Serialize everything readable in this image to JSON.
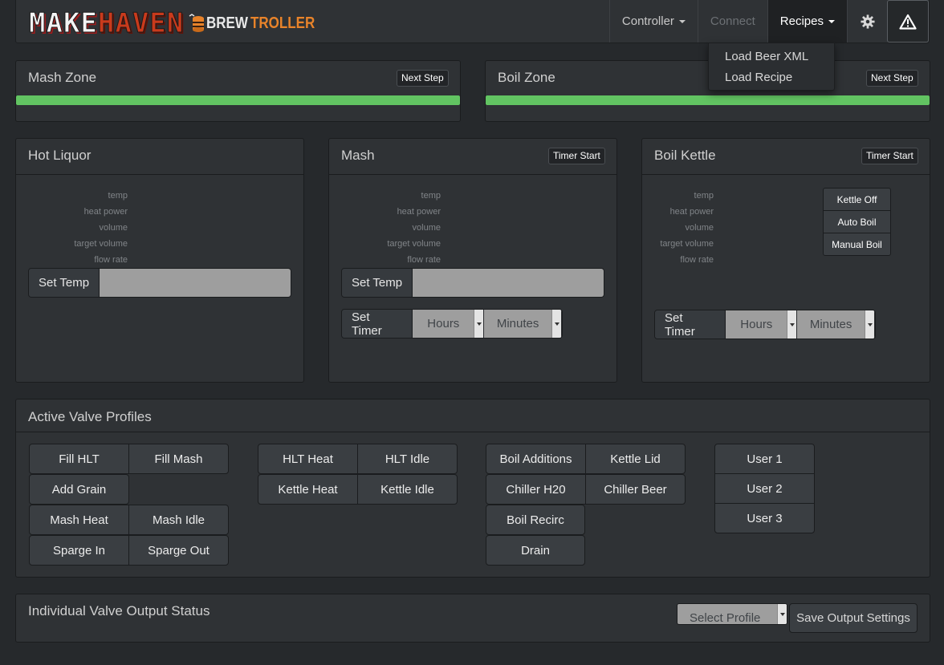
{
  "navbar": {
    "brand_make": "MAKE",
    "brand_haven": "HAVEN",
    "brand_brew": "BREW",
    "brand_troller": "TROLLER",
    "controller_label": "Controller",
    "connect_label": "Connect",
    "recipes_label": "Recipes",
    "settings_icon": "gear-icon",
    "alert_icon": "warning-icon"
  },
  "recipes_menu": {
    "items": [
      "Load Beer XML",
      "Load Recipe"
    ]
  },
  "mash_zone": {
    "title": "Mash Zone",
    "next_step": "Next Step",
    "progress": 1.0
  },
  "boil_zone": {
    "title": "Boil Zone",
    "next_step": "Next Step",
    "progress": 1.0
  },
  "vessels": {
    "field_labels": [
      "temp",
      "heat power",
      "volume",
      "target volume",
      "flow rate"
    ],
    "hot_liquor": {
      "title": "Hot Liquor",
      "set_temp": "Set Temp",
      "temp_value": ""
    },
    "mash": {
      "title": "Mash",
      "timer_start": "Timer Start",
      "set_temp": "Set Temp",
      "temp_value": "",
      "set_timer": "Set Timer",
      "hours": "Hours",
      "minutes": "Minutes"
    },
    "boil_kettle": {
      "title": "Boil Kettle",
      "timer_start": "Timer Start",
      "kettle_off": "Kettle Off",
      "auto_boil": "Auto Boil",
      "manual_boil": "Manual Boil",
      "set_timer": "Set Timer",
      "hours": "Hours",
      "minutes": "Minutes"
    }
  },
  "valve_profiles": {
    "title": "Active Valve Profiles",
    "fill_hlt": "Fill HLT",
    "fill_mash": "Fill Mash",
    "add_grain": "Add Grain",
    "mash_heat": "Mash Heat",
    "mash_idle": "Mash Idle",
    "sparge_in": "Sparge In",
    "sparge_out": "Sparge Out",
    "hlt_heat": "HLT Heat",
    "hlt_idle": "HLT Idle",
    "kettle_heat": "Kettle Heat",
    "kettle_idle": "Kettle Idle",
    "boil_additions": "Boil Additions",
    "kettle_lid": "Kettle Lid",
    "chiller_h20": "Chiller H20",
    "chiller_beer": "Chiller Beer",
    "boil_recirc": "Boil Recirc",
    "drain": "Drain",
    "user1": "User 1",
    "user2": "User 2",
    "user3": "User 3"
  },
  "valve_output": {
    "title": "Individual Valve Output Status",
    "select_profile": "Select Profile",
    "save": "Save Output Settings"
  }
}
